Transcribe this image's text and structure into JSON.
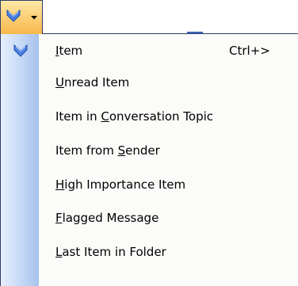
{
  "toolbar": {
    "button_icon": "blue-down-arrow-icon",
    "dropdown_icon": "dropdown-arrow-icon"
  },
  "menu": {
    "items": [
      {
        "label_pre": "",
        "mnemonic": "I",
        "label_post": "tem",
        "shortcut": "Ctrl+>",
        "icon": "blue-down-arrow-icon"
      },
      {
        "label_pre": "",
        "mnemonic": "U",
        "label_post": "nread Item",
        "shortcut": "",
        "icon": ""
      },
      {
        "label_pre": "Item in ",
        "mnemonic": "C",
        "label_post": "onversation Topic",
        "shortcut": "",
        "icon": ""
      },
      {
        "label_pre": "Item from ",
        "mnemonic": "S",
        "label_post": "ender",
        "shortcut": "",
        "icon": ""
      },
      {
        "label_pre": "",
        "mnemonic": "H",
        "label_post": "igh Importance Item",
        "shortcut": "",
        "icon": ""
      },
      {
        "label_pre": "",
        "mnemonic": "F",
        "label_post": "lagged Message",
        "shortcut": "",
        "icon": ""
      },
      {
        "label_pre": "",
        "mnemonic": "L",
        "label_post": "ast Item in Folder",
        "shortcut": "",
        "icon": ""
      }
    ]
  },
  "colors": {
    "highlight": "#fbcd72",
    "border": "#313c6a",
    "gutter": "#c5d8f6",
    "icon_blue": "#4a7fe0"
  }
}
